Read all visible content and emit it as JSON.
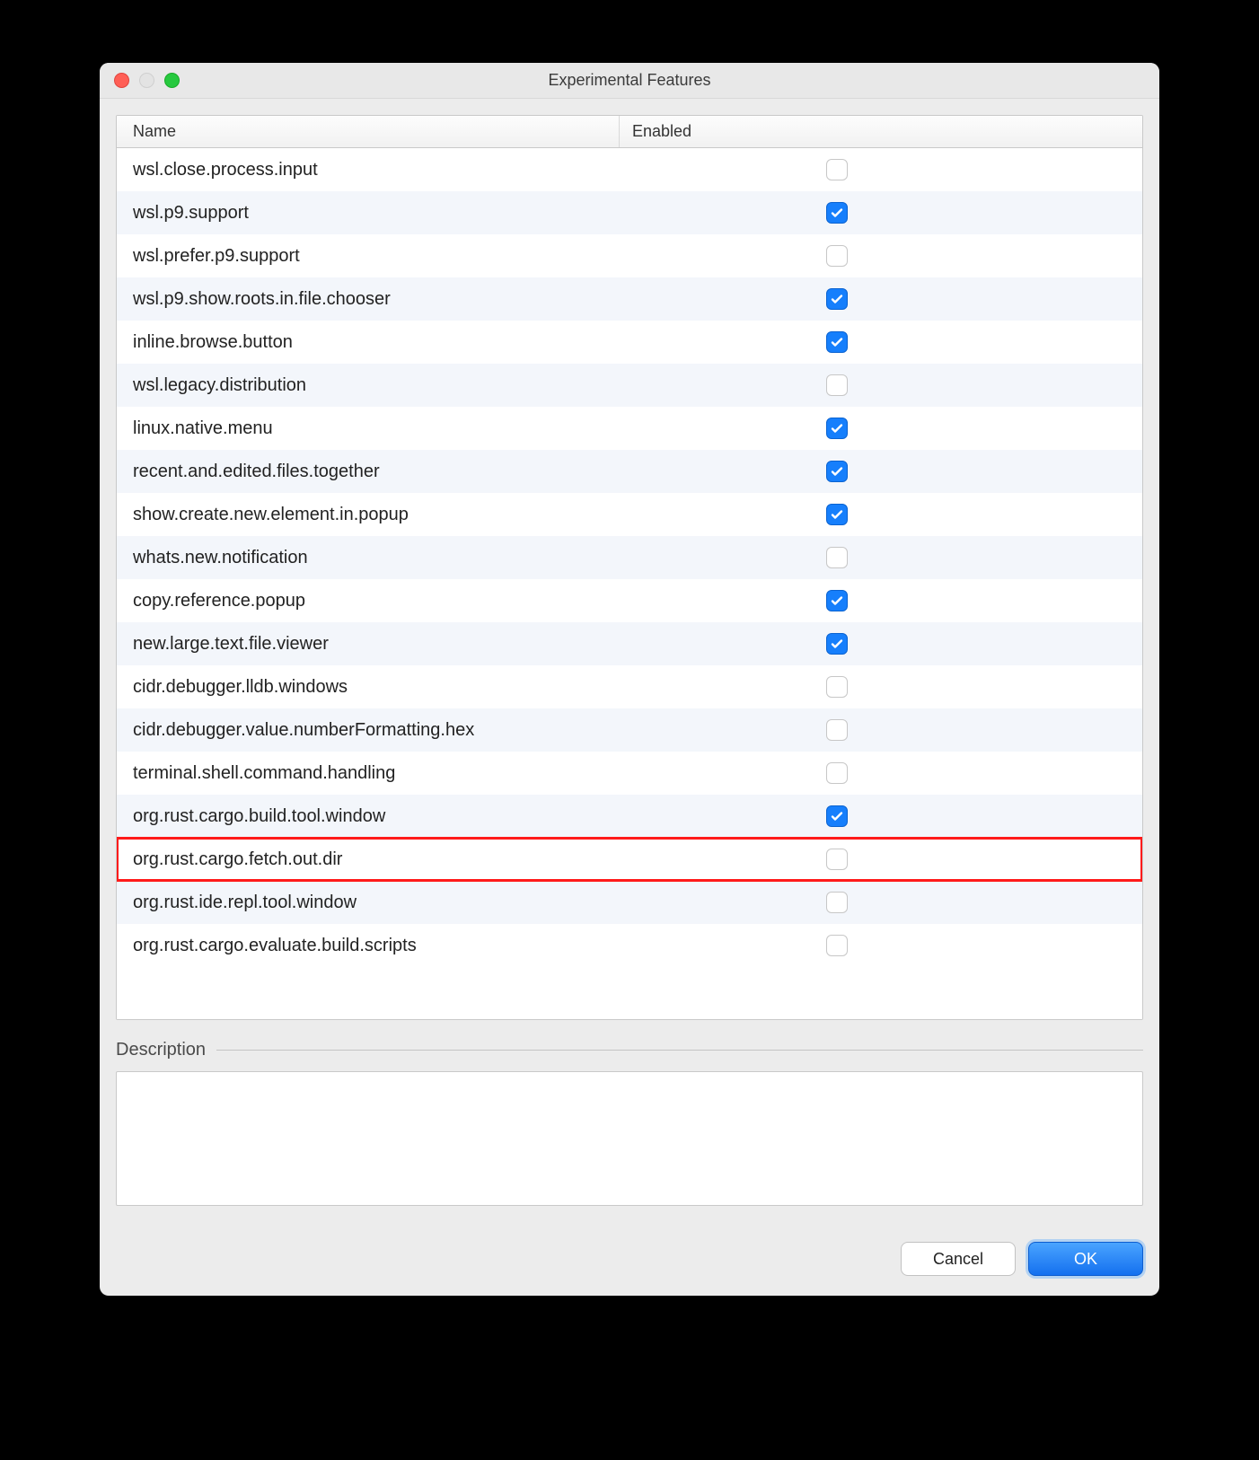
{
  "window": {
    "title": "Experimental Features"
  },
  "table": {
    "columns": {
      "name": "Name",
      "enabled": "Enabled"
    },
    "rows": [
      {
        "name": "wsl.close.process.input",
        "enabled": false,
        "highlighted": false
      },
      {
        "name": "wsl.p9.support",
        "enabled": true,
        "highlighted": false
      },
      {
        "name": "wsl.prefer.p9.support",
        "enabled": false,
        "highlighted": false
      },
      {
        "name": "wsl.p9.show.roots.in.file.chooser",
        "enabled": true,
        "highlighted": false
      },
      {
        "name": "inline.browse.button",
        "enabled": true,
        "highlighted": false
      },
      {
        "name": "wsl.legacy.distribution",
        "enabled": false,
        "highlighted": false
      },
      {
        "name": "linux.native.menu",
        "enabled": true,
        "highlighted": false
      },
      {
        "name": "recent.and.edited.files.together",
        "enabled": true,
        "highlighted": false
      },
      {
        "name": "show.create.new.element.in.popup",
        "enabled": true,
        "highlighted": false
      },
      {
        "name": "whats.new.notification",
        "enabled": false,
        "highlighted": false
      },
      {
        "name": "copy.reference.popup",
        "enabled": true,
        "highlighted": false
      },
      {
        "name": "new.large.text.file.viewer",
        "enabled": true,
        "highlighted": false
      },
      {
        "name": "cidr.debugger.lldb.windows",
        "enabled": false,
        "highlighted": false
      },
      {
        "name": "cidr.debugger.value.numberFormatting.hex",
        "enabled": false,
        "highlighted": false
      },
      {
        "name": "terminal.shell.command.handling",
        "enabled": false,
        "highlighted": false
      },
      {
        "name": "org.rust.cargo.build.tool.window",
        "enabled": true,
        "highlighted": false
      },
      {
        "name": "org.rust.cargo.fetch.out.dir",
        "enabled": false,
        "highlighted": true
      },
      {
        "name": "org.rust.ide.repl.tool.window",
        "enabled": false,
        "highlighted": false
      },
      {
        "name": "org.rust.cargo.evaluate.build.scripts",
        "enabled": false,
        "highlighted": false
      }
    ]
  },
  "description": {
    "label": "Description",
    "text": ""
  },
  "buttons": {
    "cancel": "Cancel",
    "ok": "OK"
  }
}
